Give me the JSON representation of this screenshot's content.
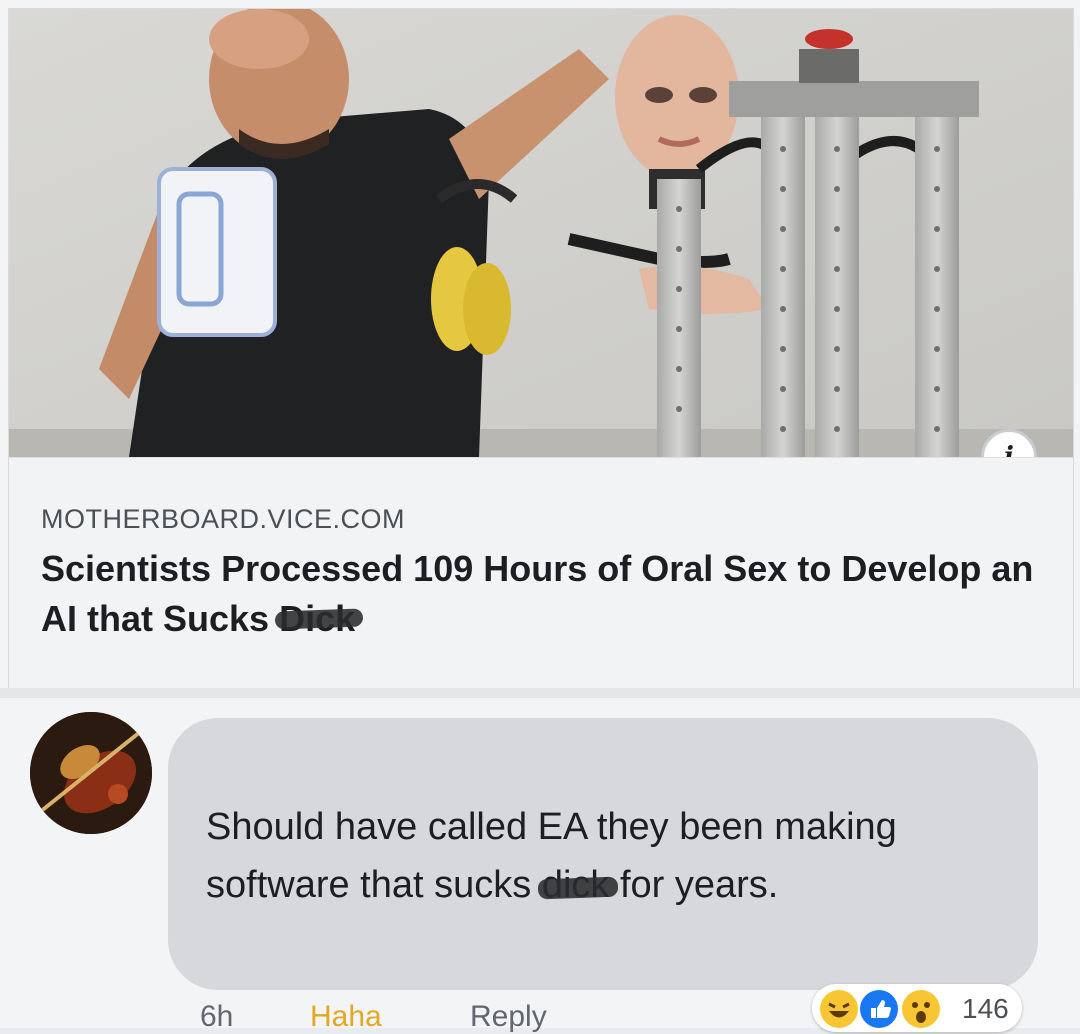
{
  "link_preview": {
    "domain": "MOTHERBOARD.VICE.COM",
    "headline_main": "Scientists Processed 109 Hours of Oral Sex to Develop an AI that Sucks",
    "headline_censored_word": "Dick",
    "info_icon": "i"
  },
  "comment": {
    "text_before": "Should have called EA they been making software that sucks",
    "censored_word": "dick",
    "text_after": "for years.",
    "time": "6h",
    "actions": [
      "Haha",
      "Reply"
    ],
    "reaction_icons": [
      "laugh-emoji-icon",
      "like-icon",
      "wow-emoji-icon"
    ],
    "reaction_count": "146"
  },
  "colors": {
    "bubble": "#d6d8dc",
    "haha_accent": "#e0a823",
    "like_blue": "#1877f2"
  }
}
